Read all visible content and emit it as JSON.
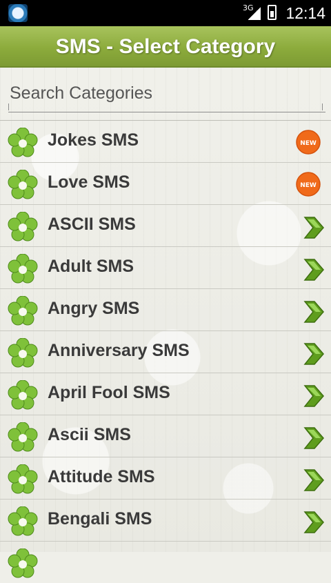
{
  "status_bar": {
    "network": "3G",
    "time": "12:14"
  },
  "header": {
    "title": "SMS - Select Category"
  },
  "search": {
    "placeholder": "Search Categories"
  },
  "badges": {
    "new": "NEW"
  },
  "categories": [
    {
      "label": "Jokes SMS",
      "indicator": "new-badge"
    },
    {
      "label": "Love SMS",
      "indicator": "new-badge"
    },
    {
      "label": "ASCII SMS",
      "indicator": "chevron-right-icon"
    },
    {
      "label": "Adult SMS",
      "indicator": "chevron-right-icon"
    },
    {
      "label": "Angry SMS",
      "indicator": "chevron-right-icon"
    },
    {
      "label": "Anniversary SMS",
      "indicator": "chevron-right-icon"
    },
    {
      "label": "April Fool SMS",
      "indicator": "chevron-right-icon"
    },
    {
      "label": "Ascii SMS",
      "indicator": "chevron-right-icon"
    },
    {
      "label": "Attitude SMS",
      "indicator": "chevron-right-icon"
    },
    {
      "label": "Bengali SMS",
      "indicator": "chevron-right-icon"
    }
  ],
  "colors": {
    "titlebar_green": "#8cab3c",
    "badge_orange": "#f06a1a",
    "chevron_green": "#5f9d1e",
    "flower_green": "#7fc13a"
  }
}
